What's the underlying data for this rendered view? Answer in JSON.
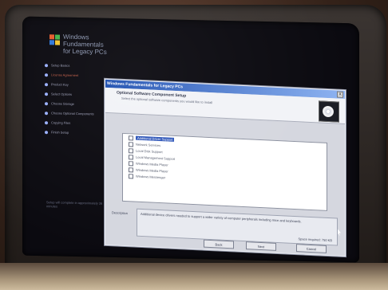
{
  "colors": {
    "accent": "#2c54b8",
    "active_step": "#ff7a5a",
    "wizard_step_dot": "#9ab0ff",
    "titlebar_start": "#1e4fb0",
    "titlebar_end": "#8fb4f2",
    "dialog_bg": "#d5d7df"
  },
  "brand": {
    "title": "Windows Fundamentals",
    "subtitle": "for Legacy PCs",
    "logo_icon": "windows-flag-icon"
  },
  "wizard": {
    "steps": [
      {
        "label": "Setup Basics",
        "active": false
      },
      {
        "label": "License Agreement",
        "active": true
      },
      {
        "label": "Product Key",
        "active": false
      },
      {
        "label": "Select Options",
        "active": false
      },
      {
        "label": "Choose Storage",
        "active": false
      },
      {
        "label": "Choose Optional Components",
        "active": false
      },
      {
        "label": "Copying Files",
        "active": false
      },
      {
        "label": "Finish Setup",
        "active": false
      }
    ],
    "bottom_note": "Setup will complete in approximately 36 minutes"
  },
  "dialog": {
    "title": "Windows Fundamentals for Legacy PCs",
    "close_label": "X",
    "header_title": "Optional Software Component Setup",
    "header_subtitle": "Select the optional software components you would like to install",
    "header_icon": "disc-icon",
    "components": [
      {
        "label": "Additional Driver Support",
        "selected": true
      },
      {
        "label": "Network Services",
        "selected": false
      },
      {
        "label": "Local Disk Support",
        "selected": false
      },
      {
        "label": "Local Management Support",
        "selected": false
      },
      {
        "label": "Windows Media Player",
        "selected": false
      },
      {
        "label": "Windows Media Player",
        "selected": false
      },
      {
        "label": "Windows Messenger",
        "selected": false
      }
    ],
    "description_label": "Description",
    "description_text": "Additional device drivers needed to support a wider variety of computer peripherals including mice and keyboards.",
    "space_required": "Space required: 750 KB",
    "buttons": {
      "back": "Back",
      "next": "Next",
      "cancel": "Cancel"
    }
  }
}
